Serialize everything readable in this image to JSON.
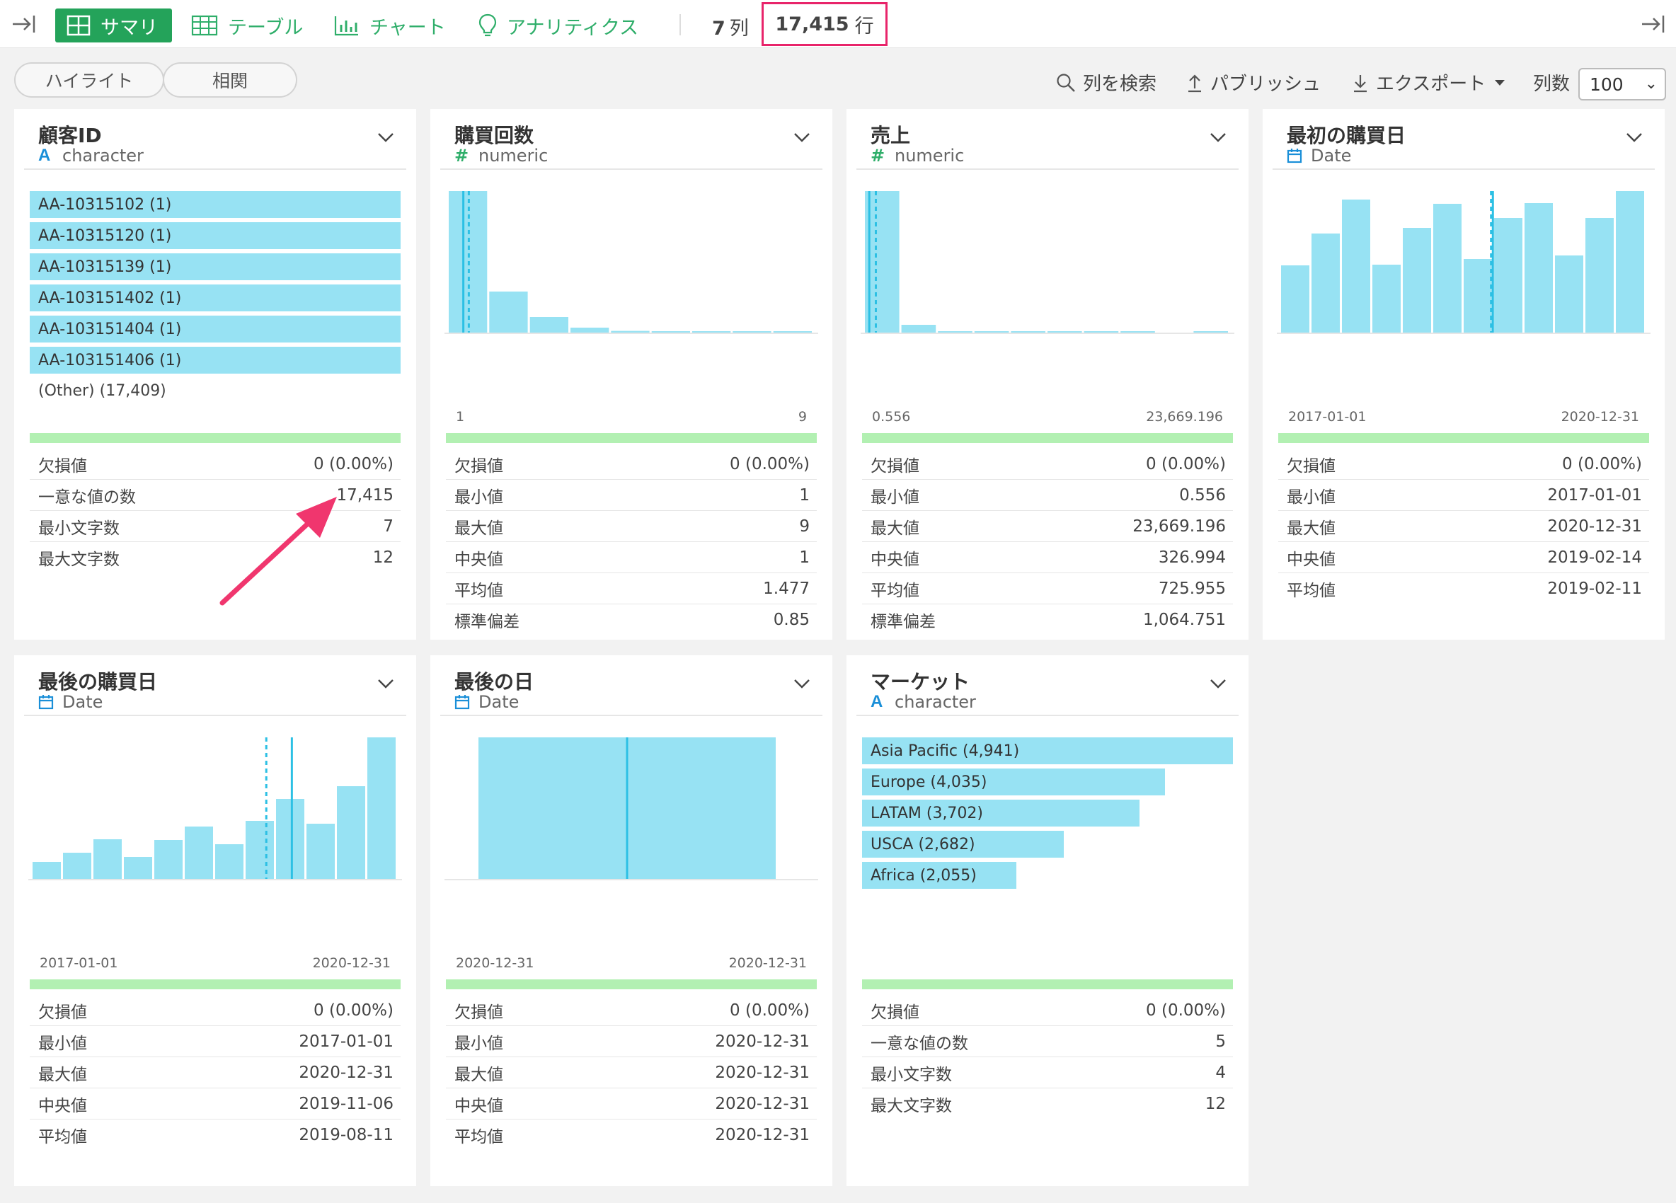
{
  "toolbar": {
    "tabs": [
      {
        "label": "サマリ",
        "active": true
      },
      {
        "label": "テーブル"
      },
      {
        "label": "チャート"
      },
      {
        "label": "アナリティクス"
      }
    ],
    "column_count": "7",
    "column_unit": "列",
    "row_count": "17,415",
    "row_unit": "行"
  },
  "subbar": {
    "highlight": "ハイライト",
    "correlation": "相関",
    "search_columns": "列を検索",
    "publish": "パブリッシュ",
    "export": "エクスポート",
    "columns_label": "列数",
    "columns_value": "100"
  },
  "cards": [
    {
      "title": "顧客ID",
      "type": "character",
      "items": [
        {
          "label": "AA-10315102 (1)",
          "fraction": 1.0
        },
        {
          "label": "AA-10315120 (1)",
          "fraction": 1.0
        },
        {
          "label": "AA-10315139 (1)",
          "fraction": 1.0
        },
        {
          "label": "AA-103151402 (1)",
          "fraction": 1.0
        },
        {
          "label": "AA-103151404 (1)",
          "fraction": 1.0
        },
        {
          "label": "AA-103151406 (1)",
          "fraction": 1.0
        }
      ],
      "other": "(Other) (17,409)",
      "stats": [
        {
          "label": "欠損値",
          "value": "0 (0.00%)"
        },
        {
          "label": "一意な値の数",
          "value": "17,415"
        },
        {
          "label": "最小文字数",
          "value": "7"
        },
        {
          "label": "最大文字数",
          "value": "12"
        }
      ]
    },
    {
      "title": "購買回数",
      "type": "numeric",
      "axis_min": "1",
      "axis_max": "9",
      "stats": [
        {
          "label": "欠損値",
          "value": "0 (0.00%)"
        },
        {
          "label": "最小値",
          "value": "1"
        },
        {
          "label": "最大値",
          "value": "9"
        },
        {
          "label": "中央値",
          "value": "1"
        },
        {
          "label": "平均値",
          "value": "1.477"
        },
        {
          "label": "標準偏差",
          "value": "0.85"
        }
      ]
    },
    {
      "title": "売上",
      "type": "numeric",
      "axis_min": "0.556",
      "axis_max": "23,669.196",
      "stats": [
        {
          "label": "欠損値",
          "value": "0 (0.00%)"
        },
        {
          "label": "最小値",
          "value": "0.556"
        },
        {
          "label": "最大値",
          "value": "23,669.196"
        },
        {
          "label": "中央値",
          "value": "326.994"
        },
        {
          "label": "平均値",
          "value": "725.955"
        },
        {
          "label": "標準偏差",
          "value": "1,064.751"
        }
      ]
    },
    {
      "title": "最初の購買日",
      "type": "Date",
      "axis_min": "2017-01-01",
      "axis_max": "2020-12-31",
      "stats": [
        {
          "label": "欠損値",
          "value": "0 (0.00%)"
        },
        {
          "label": "最小値",
          "value": "2017-01-01"
        },
        {
          "label": "最大値",
          "value": "2020-12-31"
        },
        {
          "label": "中央値",
          "value": "2019-02-14"
        },
        {
          "label": "平均値",
          "value": "2019-02-11"
        }
      ]
    },
    {
      "title": "最後の購買日",
      "type": "Date",
      "axis_min": "2017-01-01",
      "axis_max": "2020-12-31",
      "stats": [
        {
          "label": "欠損値",
          "value": "0 (0.00%)"
        },
        {
          "label": "最小値",
          "value": "2017-01-01"
        },
        {
          "label": "最大値",
          "value": "2020-12-31"
        },
        {
          "label": "中央値",
          "value": "2019-11-06"
        },
        {
          "label": "平均値",
          "value": "2019-08-11"
        }
      ]
    },
    {
      "title": "最後の日",
      "type": "Date",
      "axis_min": "2020-12-31",
      "axis_max": "2020-12-31",
      "stats": [
        {
          "label": "欠損値",
          "value": "0 (0.00%)"
        },
        {
          "label": "最小値",
          "value": "2020-12-31"
        },
        {
          "label": "最大値",
          "value": "2020-12-31"
        },
        {
          "label": "中央値",
          "value": "2020-12-31"
        },
        {
          "label": "平均値",
          "value": "2020-12-31"
        }
      ]
    },
    {
      "title": "マーケット",
      "type": "character",
      "items": [
        {
          "label": "Asia Pacific (4,941)",
          "fraction": 1.0
        },
        {
          "label": "Europe (4,035)",
          "fraction": 0.817
        },
        {
          "label": "LATAM (3,702)",
          "fraction": 0.749
        },
        {
          "label": "USCA (2,682)",
          "fraction": 0.543
        },
        {
          "label": "Africa (2,055)",
          "fraction": 0.416
        }
      ],
      "stats": [
        {
          "label": "欠損値",
          "value": "0 (0.00%)"
        },
        {
          "label": "一意な値の数",
          "value": "5"
        },
        {
          "label": "最小文字数",
          "value": "4"
        },
        {
          "label": "最大文字数",
          "value": "12"
        }
      ]
    }
  ],
  "chart_data": [
    {
      "type": "bar",
      "title": "購買回数",
      "x": [
        1,
        2,
        3,
        4,
        5,
        6,
        7,
        8,
        9
      ],
      "values": [
        1.0,
        0.29,
        0.11,
        0.035,
        0.012,
        0.005,
        0.003,
        0.002,
        0.002
      ],
      "median_line": 1,
      "mean_line": 1.477
    },
    {
      "type": "bar",
      "title": "売上",
      "values": [
        1.0,
        0.055,
        0.008,
        0.004,
        0.003,
        0.002,
        0.001,
        0.001,
        0.0,
        0.002
      ],
      "median_line": 326.994,
      "mean_line": 725.955,
      "xlim": [
        0.556,
        23669.196
      ]
    },
    {
      "type": "bar",
      "title": "最初の購買日",
      "values": [
        0.475,
        0.7,
        0.94,
        0.48,
        0.74,
        0.91,
        0.52,
        0.81,
        0.915,
        0.545,
        0.81,
        1.0
      ],
      "median_line": "2019-02-14",
      "mean_line": "2019-02-11"
    },
    {
      "type": "bar",
      "title": "最後の購買日",
      "values": [
        0.12,
        0.185,
        0.28,
        0.155,
        0.275,
        0.37,
        0.245,
        0.41,
        0.565,
        0.39,
        0.655,
        1.0
      ],
      "median_line": "2019-11-06",
      "mean_line": "2019-08-11"
    },
    {
      "type": "bar",
      "title": "最後の日",
      "values": [
        1.0
      ],
      "median_line": "2020-12-31"
    }
  ]
}
